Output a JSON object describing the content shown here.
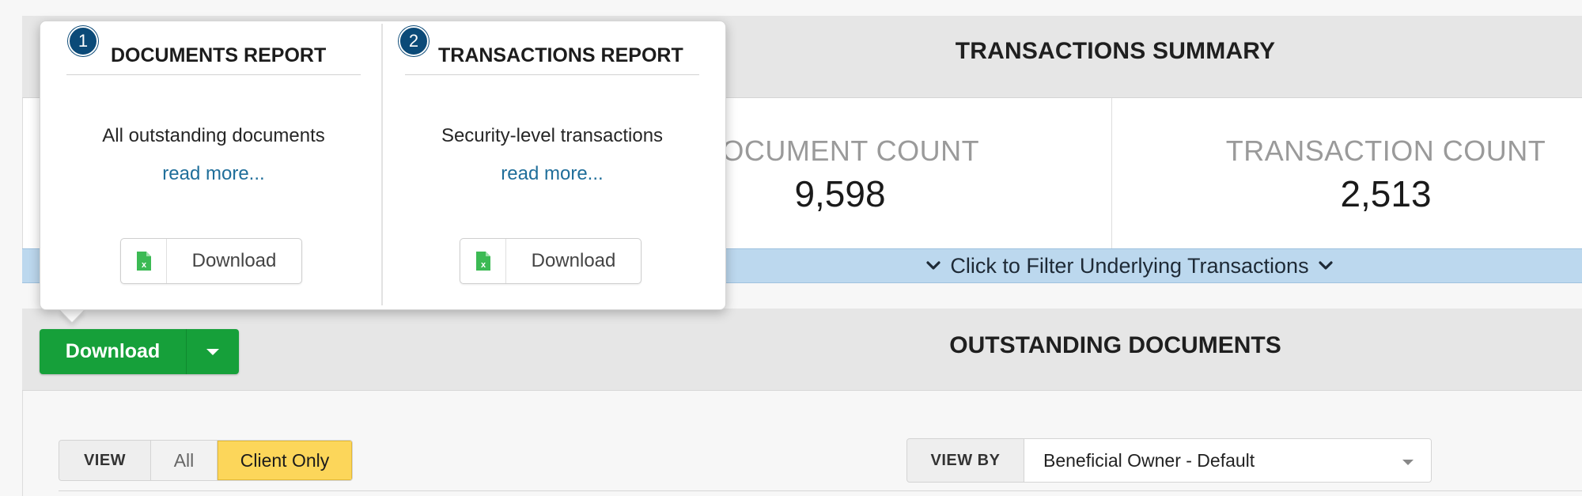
{
  "summary": {
    "title": "TRANSACTIONS SUMMARY",
    "document_count_label": "DOCUMENT COUNT",
    "document_count_value": "9,598",
    "transaction_count_label": "TRANSACTION COUNT",
    "transaction_count_value": "2,513",
    "filter_bar_text": "Click to Filter Underlying Transactions"
  },
  "download_button": {
    "label": "Download"
  },
  "popover": {
    "reports": [
      {
        "number": "1",
        "title": "DOCUMENTS REPORT",
        "description": "All outstanding documents",
        "link_text": "read more...",
        "button_label": "Download",
        "icon": "excel-file-icon"
      },
      {
        "number": "2",
        "title": "TRANSACTIONS REPORT",
        "description": "Security-level transactions",
        "link_text": "read more...",
        "button_label": "Download",
        "icon": "excel-file-icon"
      }
    ]
  },
  "outstanding": {
    "title": "OUTSTANDING DOCUMENTS",
    "view_label": "VIEW",
    "view_options": [
      "All",
      "Client Only"
    ],
    "view_selected": "Client Only",
    "view_by_label": "VIEW BY",
    "view_by_value": "Beneficial Owner - Default"
  },
  "colors": {
    "primary_green": "#16a03a",
    "badge_blue": "#0b4a78",
    "link_blue": "#1f6e9a",
    "filter_bar": "#bcd8ee",
    "selected_yellow": "#fcd65a"
  }
}
